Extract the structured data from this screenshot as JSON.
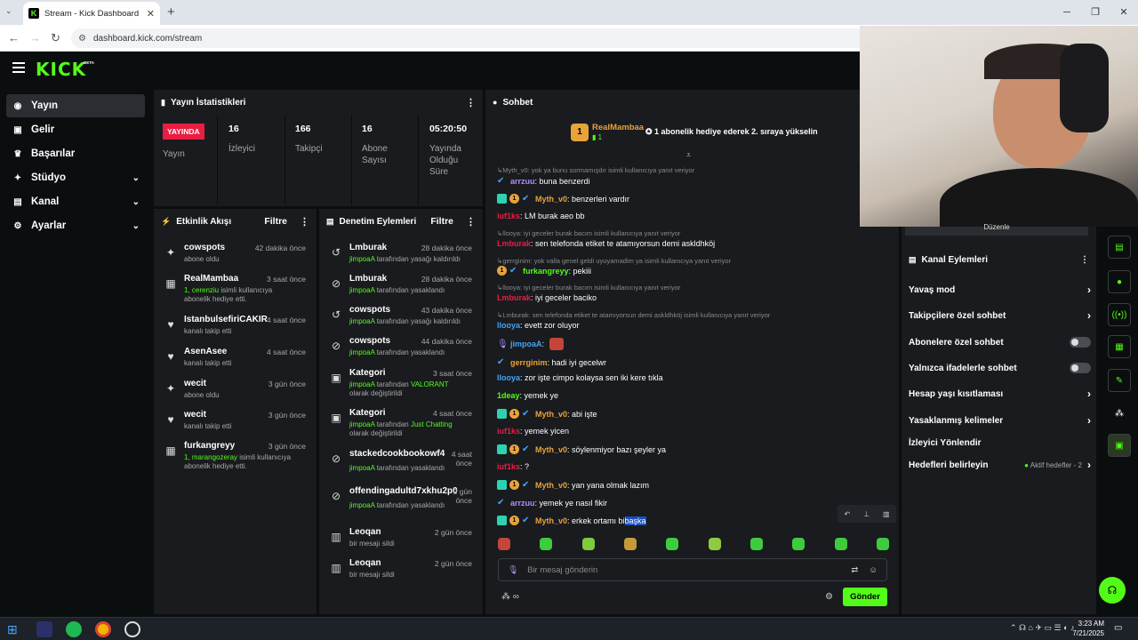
{
  "browser": {
    "tab_title": "Stream - Kick Dashboard",
    "url": "dashboard.kick.com/stream"
  },
  "header": {
    "logo": "KICK",
    "beta": "BETA"
  },
  "sidebar": {
    "items": [
      {
        "label": "Yayın",
        "icon": "broadcast-icon"
      },
      {
        "label": "Gelir",
        "icon": "money-icon"
      },
      {
        "label": "Başarılar",
        "icon": "trophy-icon"
      },
      {
        "label": "Stüdyo",
        "icon": "studio-icon"
      },
      {
        "label": "Kanal",
        "icon": "channel-icon"
      },
      {
        "label": "Ayarlar",
        "icon": "gear-icon"
      }
    ]
  },
  "stats": {
    "title": "Yayın İstatistikleri",
    "live_badge": "YAYINDA",
    "live_label": "Yayın",
    "items": [
      {
        "value": "16",
        "label": "İzleyici"
      },
      {
        "value": "166",
        "label": "Takipçi"
      },
      {
        "value": "16",
        "label": "Abone Sayısı"
      },
      {
        "value": "05:20:50",
        "label": "Yayında Olduğu Süre"
      }
    ]
  },
  "activity": {
    "title": "Etkinlik Akışı",
    "filter": "Filtre",
    "items": [
      {
        "name": "cowspots",
        "time": "42 dakika önce",
        "sub": "abone oldu"
      },
      {
        "name": "RealMambaa",
        "time": "3 saat önce",
        "sub_hl": "1, cerenziu",
        "sub": " isimli kullanıcıya abonelik hediye etti."
      },
      {
        "name": "IstanbulsefiriCAKIR",
        "time": "4 saat önce",
        "sub": "kanalı takip etti"
      },
      {
        "name": "AsenAsee",
        "time": "4 saat önce",
        "sub": "kanalı takip etti"
      },
      {
        "name": "wecit",
        "time": "3 gün önce",
        "sub": "abone oldu"
      },
      {
        "name": "wecit",
        "time": "3 gün önce",
        "sub": "kanalı takip etti"
      },
      {
        "name": "furkangreyy",
        "time": "3 gün önce",
        "sub_hl": "1, marangozeray",
        "sub": " isimli kullanıcıya abonelik hediye etti."
      }
    ]
  },
  "moderation": {
    "title": "Denetim Eylemleri",
    "filter": "Filtre",
    "items": [
      {
        "name": "Lmburak",
        "time": "28 dakika önce",
        "by": "jimpoaA",
        "sub": " tarafından yasağı kaldırıldı"
      },
      {
        "name": "Lmburak",
        "time": "28 dakika önce",
        "by": "jimpoaA",
        "sub": " tarafından yasaklandı"
      },
      {
        "name": "cowspots",
        "time": "43 dakika önce",
        "by": "jimpoaA",
        "sub": " tarafından yasağı kaldırıldı"
      },
      {
        "name": "cowspots",
        "time": "44 dakika önce",
        "by": "jimpoaA",
        "sub": " tarafından yasaklandı"
      },
      {
        "name": "Kategori",
        "time": "3 saat önce",
        "by": "jimpoaA",
        "sub": " tarafından ",
        "extra": "VALORANT",
        "sub2": "olarak değiştirildi"
      },
      {
        "name": "Kategori",
        "time": "4 saat önce",
        "by": "jimpoaA",
        "sub": " tarafından ",
        "extra": "Just Chatting",
        "sub2": "olarak değiştirildi"
      },
      {
        "name": "stackedcookbookowf4",
        "time": "4 saat önce",
        "by": "jimpoaA",
        "sub": " tarafından yasaklandı"
      },
      {
        "name": "offendingadultd7xkhu2p0",
        "time": "2 gün önce",
        "by": "jimpoaA",
        "sub": " tarafından yasaklandı"
      },
      {
        "name": "Leoqan",
        "time": "2 gün önce",
        "sub": "bir mesajı sildi"
      },
      {
        "name": "Leoqan",
        "time": "2 gün önce",
        "sub": "bir mesajı sildi"
      }
    ]
  },
  "chat": {
    "title": "Sohbet",
    "pinned_user": "RealMambaa",
    "pinned_count": "1",
    "pinned_msg": "1 abonelik hediye ederek 2. sıraya yükselin",
    "messages": [
      {
        "type": "reply",
        "text": "Myth_v0: yok ya bunu sormamışdır isimli kullanıcıya yanıt veriyor"
      },
      {
        "user": "arrzuu",
        "color": "#b48cff",
        "text": ": buna benzerdi",
        "badges": "v"
      },
      {
        "user": "Myth_v0",
        "color": "#e8a33a",
        "text": ": benzerleri vardır",
        "badges": "ksv"
      },
      {
        "user": "iuf1ks",
        "color": "#e91e43",
        "text": ": LM burak aeo bb",
        "badges": ""
      },
      {
        "type": "reply",
        "text": "llooya: iyi geceler burak bacım isimli kullanıcıya yanıt veriyor"
      },
      {
        "user": "Lmburak",
        "color": "#e91e43",
        "text": ": sen telefonda etiket te atamıyorsun demi askldhköj",
        "badges": ""
      },
      {
        "type": "reply",
        "text": "gerrginim: yok valla genel geldi uyuyamadim ya isimli kullanıcıya yanıt veriyor"
      },
      {
        "user": "furkangreyy",
        "color": "#53fc18",
        "text": ": pekiii",
        "badges": "sv"
      },
      {
        "type": "reply",
        "text": "llooya: iyi geceler burak bacım isimli kullanıcıya yanıt veriyor"
      },
      {
        "user": "Lmburak",
        "color": "#e91e43",
        "text": ": iyi geceler baciko",
        "badges": ""
      },
      {
        "type": "reply",
        "text": "Lmburak: sen telefonda etiket te atamıyorsun demi askldhköj isimli kullanıcıya yanıt veriyor"
      },
      {
        "user": "llooya",
        "color": "#42a5f5",
        "text": ": evett zor oluyor",
        "badges": ""
      },
      {
        "user": "jimpoaA",
        "color": "#42a5f5",
        "text": ":",
        "badges": "m",
        "emote": true
      },
      {
        "user": "gerrginim",
        "color": "#e8a33a",
        "text": ": hadi iyi gecelwr",
        "badges": "v"
      },
      {
        "user": "llooya",
        "color": "#42a5f5",
        "text": ": zor işte cimpo kolaysa sen iki kere tıkla",
        "badges": ""
      },
      {
        "user": "1deay",
        "color": "#53fc18",
        "text": ": yemek ye",
        "badges": ""
      },
      {
        "user": "Myth_v0",
        "color": "#e8a33a",
        "text": ": abi işte",
        "badges": "ksv"
      },
      {
        "user": "iuf1ks",
        "color": "#e91e43",
        "text": ": yemek yicen",
        "badges": ""
      },
      {
        "user": "Myth_v0",
        "color": "#e8a33a",
        "text": ": söylenmiyor bazı şeyler ya",
        "badges": "ksv"
      },
      {
        "user": "iuf1ks",
        "color": "#e91e43",
        "text": ": ?",
        "badges": ""
      },
      {
        "user": "Myth_v0",
        "color": "#e8a33a",
        "text": ": yan yana olmak lazım",
        "badges": "ksv"
      },
      {
        "user": "arrzuu",
        "color": "#b48cff",
        "text": ": yemek ye nasıl fikir",
        "badges": "v"
      },
      {
        "user": "Myth_v0",
        "color": "#e8a33a",
        "text": ": erkek ortamı bi ",
        "hl": "başka",
        "badges": "ksv"
      }
    ],
    "input_placeholder": "Bir mesaj gönderin",
    "send_label": "Gönder"
  },
  "channel_actions": {
    "title": "Kanal Eylemleri",
    "top_btn": "Düzenle",
    "rows": [
      {
        "label": "Yavaş mod",
        "kind": "chev"
      },
      {
        "label": "Takipçilere özel sohbet",
        "kind": "chev"
      },
      {
        "label": "Abonelere özel sohbet",
        "kind": "toggle"
      },
      {
        "label": "Yalnızca ifadelerle sohbet",
        "kind": "toggle"
      },
      {
        "label": "Hesap yaşı kısıtlaması",
        "kind": "chev"
      },
      {
        "label": "Yasaklanmış kelimeler",
        "kind": "chev"
      },
      {
        "label": "İzleyici Yönlendir",
        "kind": "none"
      },
      {
        "label": "Hedefleri belirleyin",
        "kind": "goal",
        "extra": "Aktif hedefler - 2"
      }
    ]
  },
  "taskbar": {
    "time": "3:23 AM",
    "date": "7/21/2025"
  }
}
